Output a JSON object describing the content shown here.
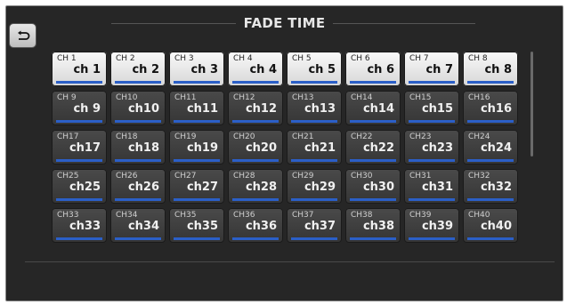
{
  "title": "FADE TIME",
  "icons": {
    "back": "return-arrow-icon"
  },
  "colors": {
    "accent_bar": "#2b5fc7",
    "background": "#262626"
  },
  "channels": [
    {
      "num": "CH 1",
      "name": "ch 1",
      "selected": true
    },
    {
      "num": "CH 2",
      "name": "ch 2",
      "selected": true
    },
    {
      "num": "CH 3",
      "name": "ch 3",
      "selected": true
    },
    {
      "num": "CH 4",
      "name": "ch 4",
      "selected": true
    },
    {
      "num": "CH 5",
      "name": "ch 5",
      "selected": true
    },
    {
      "num": "CH 6",
      "name": "ch 6",
      "selected": true
    },
    {
      "num": "CH 7",
      "name": "ch 7",
      "selected": true
    },
    {
      "num": "CH 8",
      "name": "ch 8",
      "selected": true
    },
    {
      "num": "CH 9",
      "name": "ch 9",
      "selected": false
    },
    {
      "num": "CH10",
      "name": "ch10",
      "selected": false
    },
    {
      "num": "CH11",
      "name": "ch11",
      "selected": false
    },
    {
      "num": "CH12",
      "name": "ch12",
      "selected": false
    },
    {
      "num": "CH13",
      "name": "ch13",
      "selected": false
    },
    {
      "num": "CH14",
      "name": "ch14",
      "selected": false
    },
    {
      "num": "CH15",
      "name": "ch15",
      "selected": false
    },
    {
      "num": "CH16",
      "name": "ch16",
      "selected": false
    },
    {
      "num": "CH17",
      "name": "ch17",
      "selected": false
    },
    {
      "num": "CH18",
      "name": "ch18",
      "selected": false
    },
    {
      "num": "CH19",
      "name": "ch19",
      "selected": false
    },
    {
      "num": "CH20",
      "name": "ch20",
      "selected": false
    },
    {
      "num": "CH21",
      "name": "ch21",
      "selected": false
    },
    {
      "num": "CH22",
      "name": "ch22",
      "selected": false
    },
    {
      "num": "CH23",
      "name": "ch23",
      "selected": false
    },
    {
      "num": "CH24",
      "name": "ch24",
      "selected": false
    },
    {
      "num": "CH25",
      "name": "ch25",
      "selected": false
    },
    {
      "num": "CH26",
      "name": "ch26",
      "selected": false
    },
    {
      "num": "CH27",
      "name": "ch27",
      "selected": false
    },
    {
      "num": "CH28",
      "name": "ch28",
      "selected": false
    },
    {
      "num": "CH29",
      "name": "ch29",
      "selected": false
    },
    {
      "num": "CH30",
      "name": "ch30",
      "selected": false
    },
    {
      "num": "CH31",
      "name": "ch31",
      "selected": false
    },
    {
      "num": "CH32",
      "name": "ch32",
      "selected": false
    },
    {
      "num": "CH33",
      "name": "ch33",
      "selected": false
    },
    {
      "num": "CH34",
      "name": "ch34",
      "selected": false
    },
    {
      "num": "CH35",
      "name": "ch35",
      "selected": false
    },
    {
      "num": "CH36",
      "name": "ch36",
      "selected": false
    },
    {
      "num": "CH37",
      "name": "ch37",
      "selected": false
    },
    {
      "num": "CH38",
      "name": "ch38",
      "selected": false
    },
    {
      "num": "CH39",
      "name": "ch39",
      "selected": false
    },
    {
      "num": "CH40",
      "name": "ch40",
      "selected": false
    }
  ]
}
